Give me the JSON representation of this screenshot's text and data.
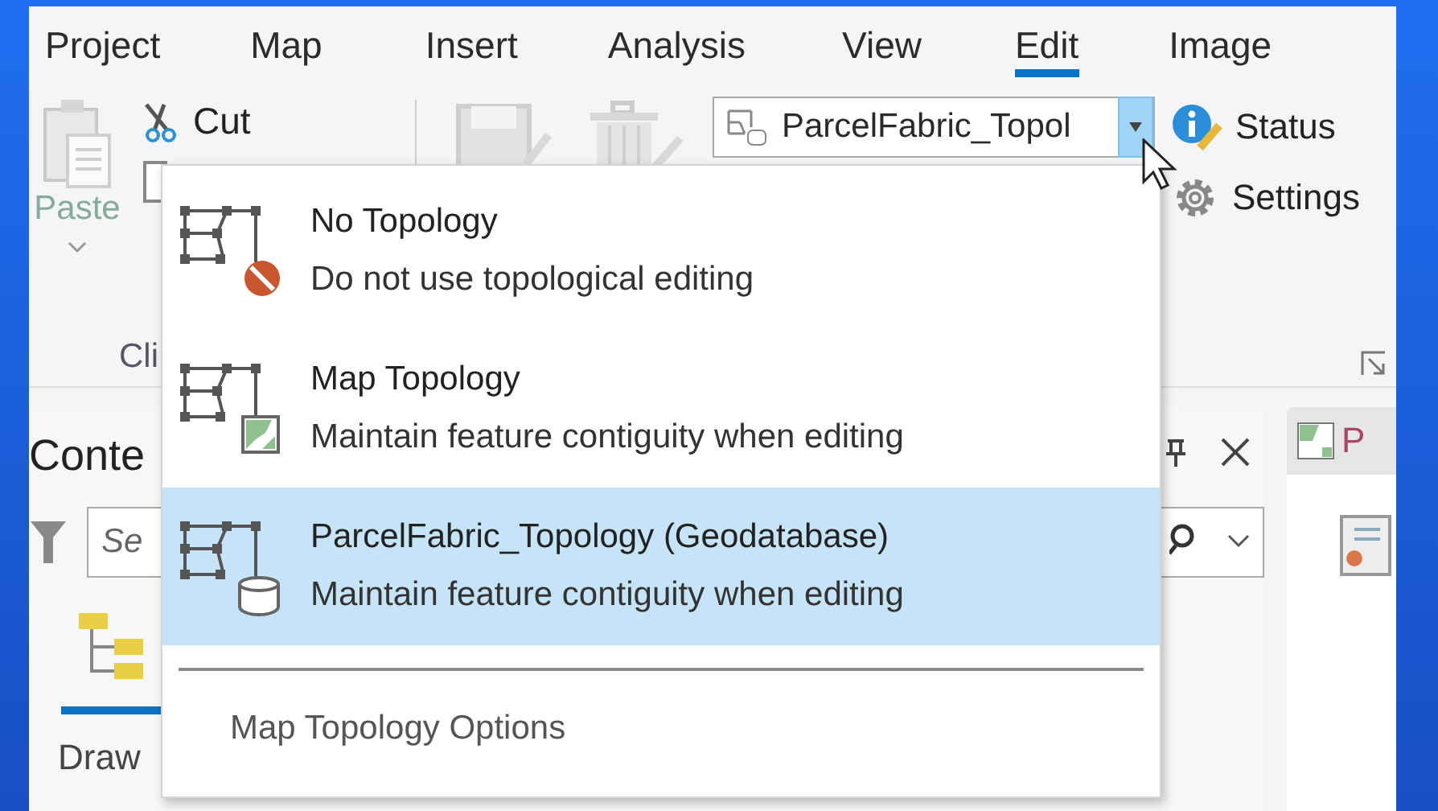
{
  "ribbon_tabs": [
    {
      "label": "Project",
      "selected": false
    },
    {
      "label": "Map",
      "selected": false
    },
    {
      "label": "Insert",
      "selected": false
    },
    {
      "label": "Analysis",
      "selected": false
    },
    {
      "label": "View",
      "selected": false
    },
    {
      "label": "Edit",
      "selected": true
    },
    {
      "label": "Image",
      "selected": false
    }
  ],
  "clipboard": {
    "paste": "Paste",
    "cut": "Cut",
    "group_label": "Cli"
  },
  "topology_combo": {
    "value": "ParcelFabric_Topol"
  },
  "status_button": "Status",
  "settings_button": "Settings",
  "contents_pane": {
    "title": "Conte",
    "search_placeholder": "Se",
    "drawing_order": "Draw"
  },
  "map_pane": {
    "tab": "P"
  },
  "topology_menu": {
    "items": [
      {
        "kind": "none",
        "title": "No Topology",
        "description": "Do not use topological editing",
        "selected": false
      },
      {
        "kind": "map",
        "title": "Map Topology",
        "description": "Maintain feature contiguity when editing",
        "selected": false
      },
      {
        "kind": "geodatabase",
        "title": "ParcelFabric_Topology (Geodatabase)",
        "description": "Maintain feature contiguity when editing",
        "selected": true
      }
    ],
    "options": "Map Topology Options"
  }
}
